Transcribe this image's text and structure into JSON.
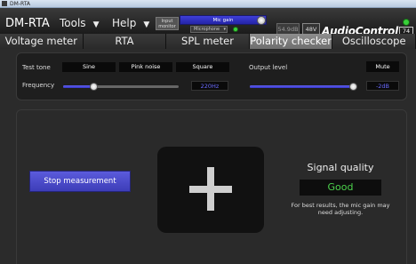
{
  "window": {
    "title": "DM-RTA"
  },
  "menubar": {
    "app_name": "DM-RTA",
    "menus": [
      {
        "label": "Tools",
        "caret": "▼"
      },
      {
        "label": "Help",
        "caret": "▼"
      }
    ],
    "input_monitor": "Input monitor",
    "mic_gain_label": "Mic gain",
    "input_source": "Microphone",
    "level_db": "54.9dB",
    "phantom_power": "48V",
    "brand": "AudioControl",
    "battery_percent": "74"
  },
  "tabs": [
    {
      "label": "Voltage meter",
      "active": false
    },
    {
      "label": "RTA",
      "active": false
    },
    {
      "label": "SPL meter",
      "active": false
    },
    {
      "label": "Polarity checker",
      "active": true
    },
    {
      "label": "Oscilloscope",
      "active": false
    }
  ],
  "settings": {
    "test_tone_label": "Test tone",
    "tone_options": [
      "Sine",
      "Pink noise",
      "Square"
    ],
    "output_level_label": "Output level",
    "mute_label": "Mute",
    "frequency_label": "Frequency",
    "frequency_value": "220Hz",
    "frequency_slider_level": 0.26,
    "output_level_value": "-2dB",
    "output_slider_level": 0.97
  },
  "main": {
    "stop_button": "Stop measurement",
    "polarity_symbol": "plus",
    "signal_quality_title": "Signal quality",
    "signal_quality_value": "Good",
    "note": "For best results, the mic gain may need adjusting."
  },
  "colors": {
    "accent_blue": "#4444cc",
    "good_green": "#4cd24c",
    "active_tab": "#7e7e7e"
  }
}
